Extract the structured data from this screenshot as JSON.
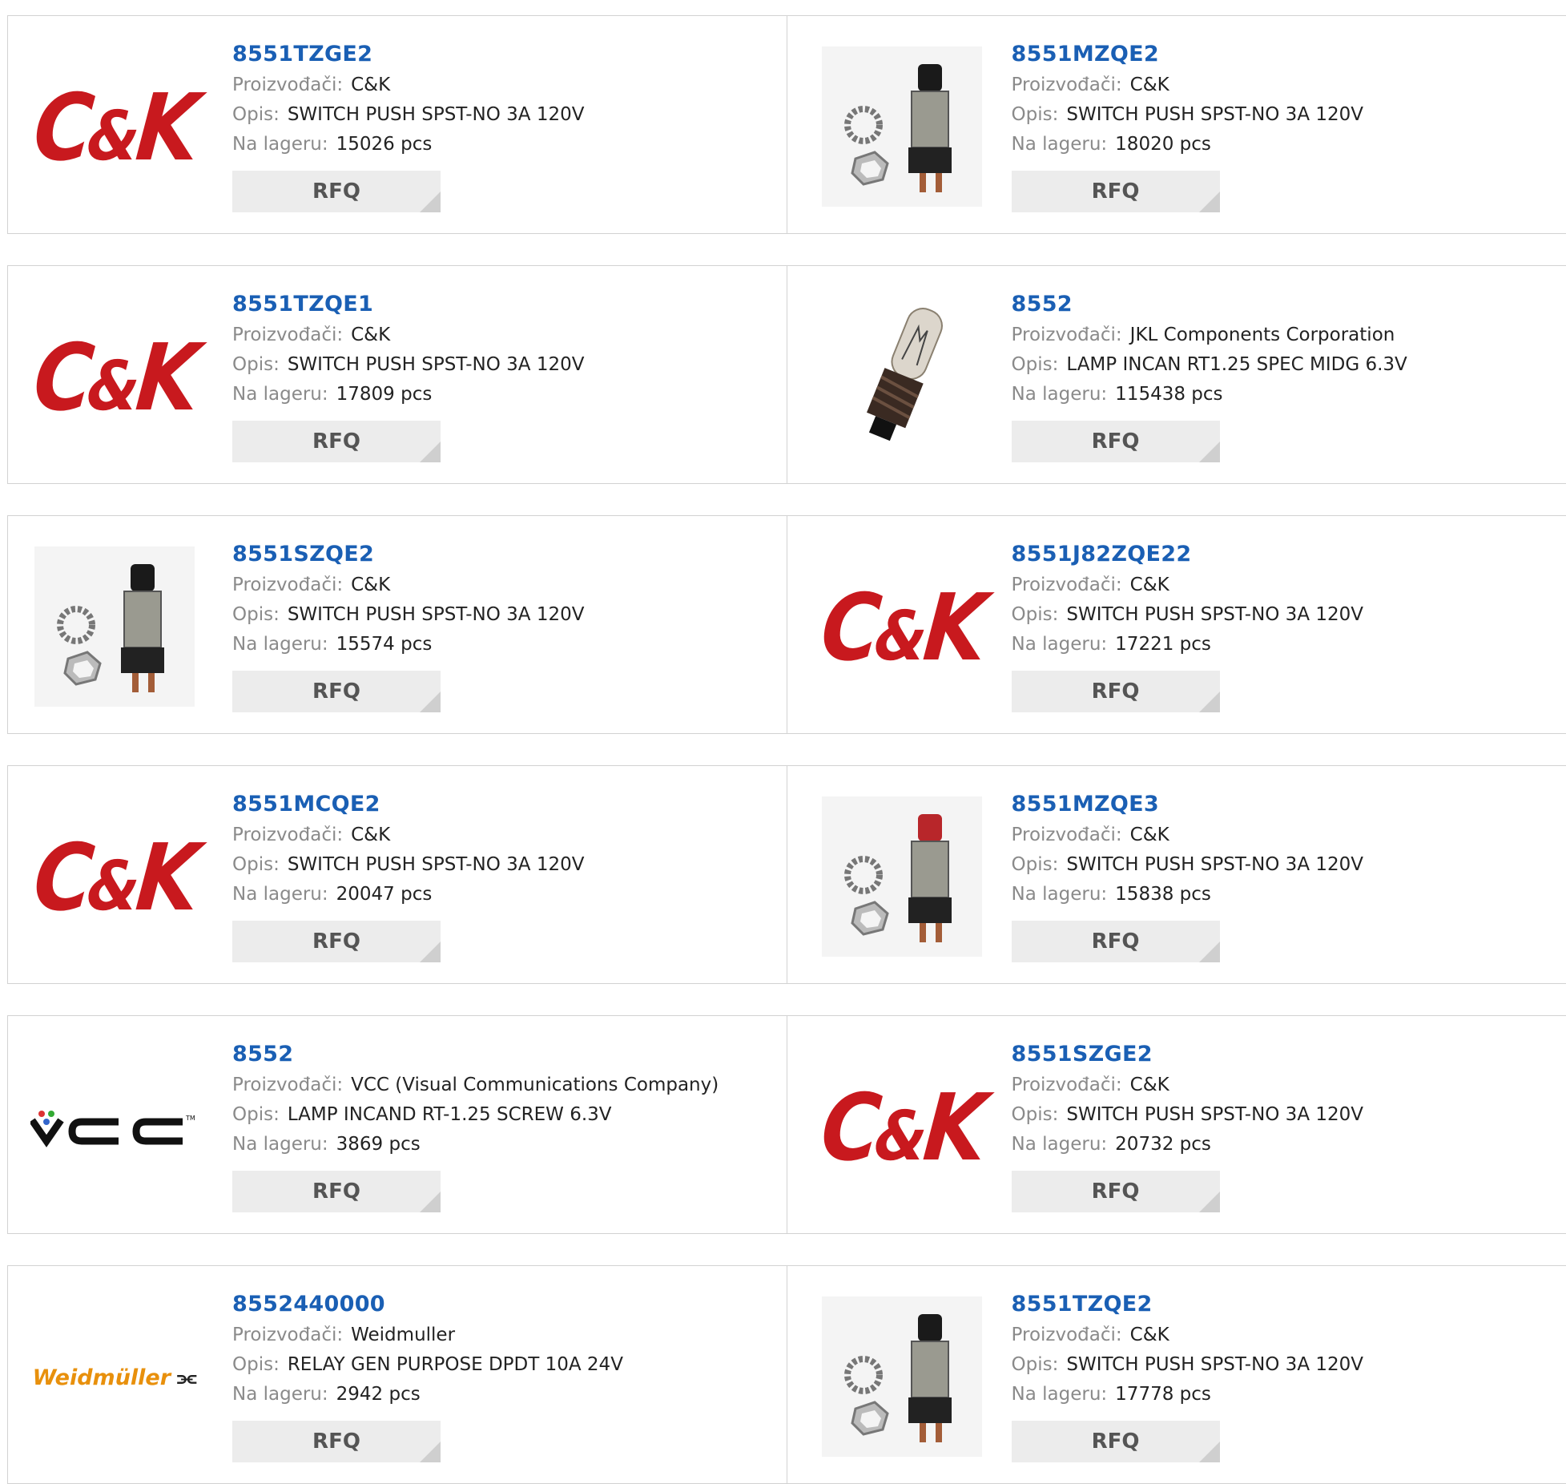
{
  "colors": {
    "title": "#1a5fb4",
    "ck_red": "#c8191e",
    "weidmuller_orange": "#e8900c"
  },
  "labels": {
    "manufacturer": "Proizvođači:",
    "description": "Opis:",
    "stock": "Na lageru:",
    "rfq": "RFQ"
  },
  "products": [
    {
      "part": "8551TZGE2",
      "manufacturer": "C&K",
      "description": "SWITCH PUSH SPST-NO 3A 120V",
      "stock": "15026 pcs",
      "image": "ck-logo"
    },
    {
      "part": "8551MZQE2",
      "manufacturer": "C&K",
      "description": "SWITCH PUSH SPST-NO 3A 120V",
      "stock": "18020 pcs",
      "image": "pushbutton-black"
    },
    {
      "part": "8551TZQE1",
      "manufacturer": "C&K",
      "description": "SWITCH PUSH SPST-NO 3A 120V",
      "stock": "17809 pcs",
      "image": "ck-logo"
    },
    {
      "part": "8552",
      "manufacturer": "JKL Components Corporation",
      "description": "LAMP INCAN RT1.25 SPEC MIDG 6.3V",
      "stock": "115438 pcs",
      "image": "lamp"
    },
    {
      "part": "8551SZQE2",
      "manufacturer": "C&K",
      "description": "SWITCH PUSH SPST-NO 3A 120V",
      "stock": "15574 pcs",
      "image": "pushbutton-black"
    },
    {
      "part": "8551J82ZQE22",
      "manufacturer": "C&K",
      "description": "SWITCH PUSH SPST-NO 3A 120V",
      "stock": "17221 pcs",
      "image": "ck-logo"
    },
    {
      "part": "8551MCQE2",
      "manufacturer": "C&K",
      "description": "SWITCH PUSH SPST-NO 3A 120V",
      "stock": "20047 pcs",
      "image": "ck-logo"
    },
    {
      "part": "8551MZQE3",
      "manufacturer": "C&K",
      "description": "SWITCH PUSH SPST-NO 3A 120V",
      "stock": "15838 pcs",
      "image": "pushbutton-red"
    },
    {
      "part": "8552",
      "manufacturer": "VCC (Visual Communications Company)",
      "description": "LAMP INCAND RT-1.25 SCREW 6.3V",
      "stock": "3869 pcs",
      "image": "vcc-logo"
    },
    {
      "part": "8551SZGE2",
      "manufacturer": "C&K",
      "description": "SWITCH PUSH SPST-NO 3A 120V",
      "stock": "20732 pcs",
      "image": "ck-logo"
    },
    {
      "part": "8552440000",
      "manufacturer": "Weidmuller",
      "description": "RELAY GEN PURPOSE DPDT 10A 24V",
      "stock": "2942 pcs",
      "image": "weidmuller-logo"
    },
    {
      "part": "8551TZQE2",
      "manufacturer": "C&K",
      "description": "SWITCH PUSH SPST-NO 3A 120V",
      "stock": "17778 pcs",
      "image": "pushbutton-black"
    }
  ],
  "logos": {
    "ck": {
      "c": "C",
      "amp": "&",
      "k": "K"
    },
    "weidmuller": "Weidmüller"
  }
}
